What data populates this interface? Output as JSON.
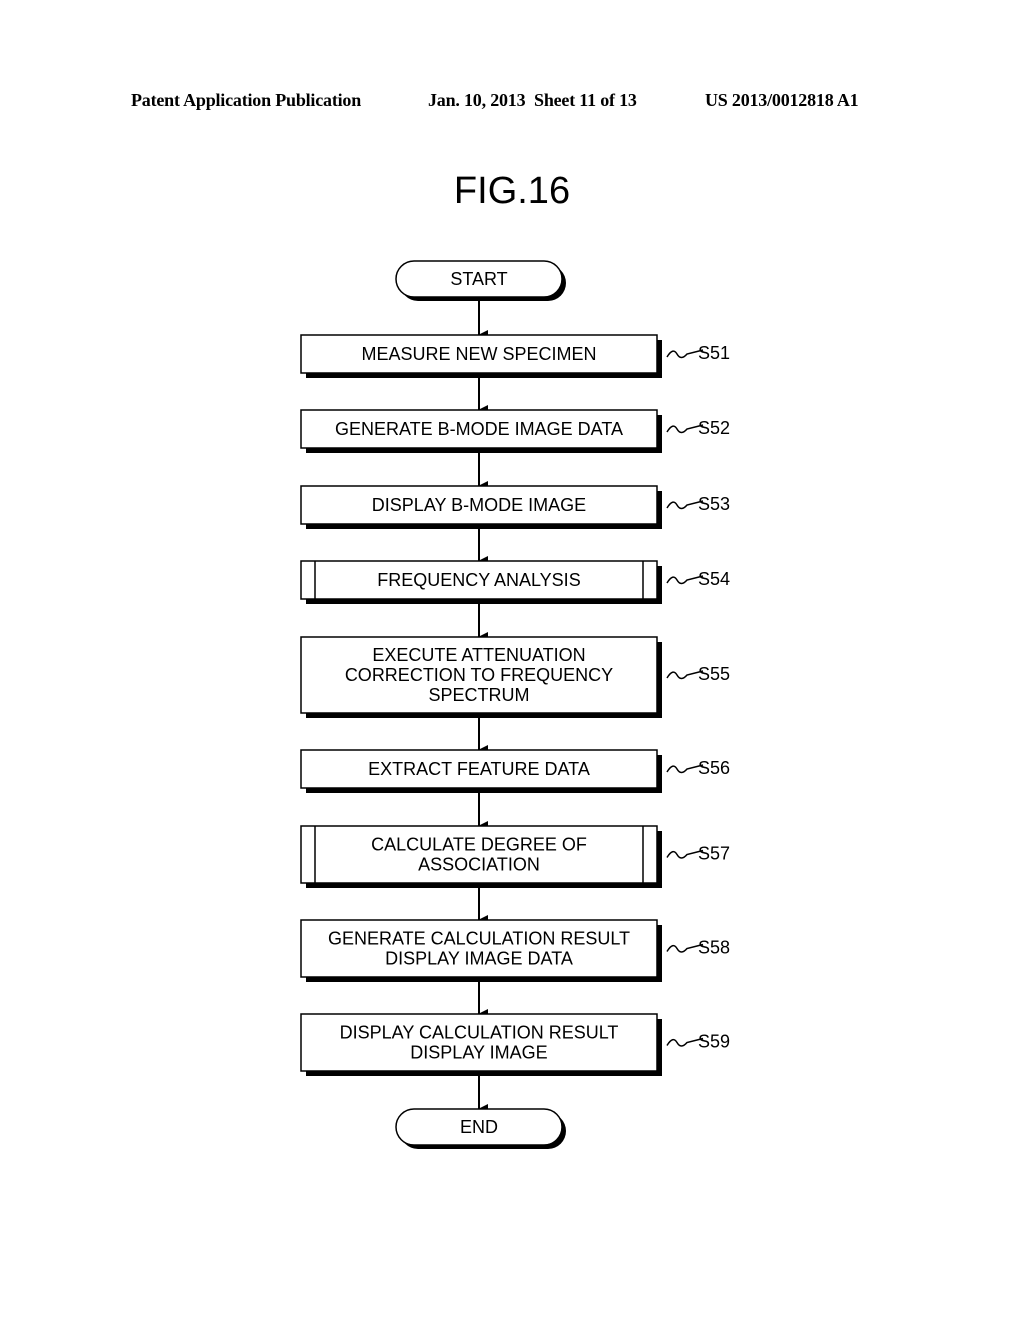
{
  "header": {
    "publication": "Patent Application Publication",
    "date_sheet": "Jan. 10, 2013  Sheet 11 of 13",
    "number": "US 2013/0012818 A1"
  },
  "figure": {
    "title": "FIG.16"
  },
  "flowchart": {
    "start": "START",
    "end": "END",
    "steps": [
      {
        "id": "S51",
        "lines": [
          "MEASURE NEW SPECIMEN"
        ],
        "type": "process"
      },
      {
        "id": "S52",
        "lines": [
          "GENERATE B-MODE IMAGE DATA"
        ],
        "type": "process"
      },
      {
        "id": "S53",
        "lines": [
          "DISPLAY B-MODE IMAGE"
        ],
        "type": "process"
      },
      {
        "id": "S54",
        "lines": [
          "FREQUENCY ANALYSIS"
        ],
        "type": "subroutine"
      },
      {
        "id": "S55",
        "lines": [
          "EXECUTE ATTENUATION",
          "CORRECTION TO FREQUENCY",
          "SPECTRUM"
        ],
        "type": "process"
      },
      {
        "id": "S56",
        "lines": [
          "EXTRACT FEATURE DATA"
        ],
        "type": "process"
      },
      {
        "id": "S57",
        "lines": [
          "CALCULATE DEGREE OF",
          "ASSOCIATION"
        ],
        "type": "subroutine"
      },
      {
        "id": "S58",
        "lines": [
          "GENERATE CALCULATION RESULT",
          "DISPLAY IMAGE DATA"
        ],
        "type": "process"
      },
      {
        "id": "S59",
        "lines": [
          "DISPLAY CALCULATION RESULT",
          "DISPLAY IMAGE"
        ],
        "type": "process"
      }
    ]
  }
}
